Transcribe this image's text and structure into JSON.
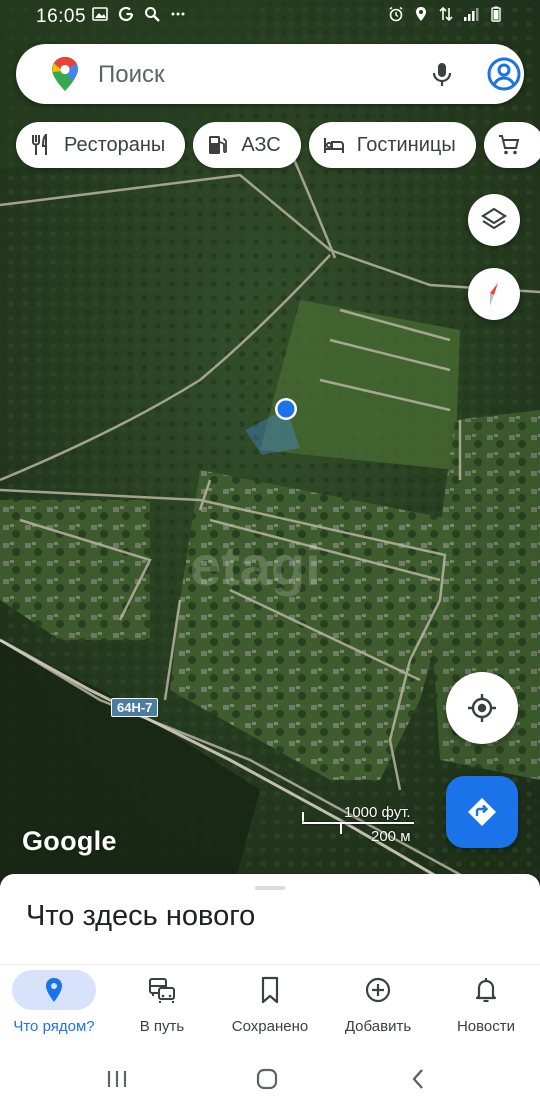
{
  "status_bar": {
    "time": "16:05",
    "left_icons": [
      "image-icon",
      "google-g-icon",
      "search-icon",
      "more-dots-icon"
    ],
    "right_icons": [
      "alarm-icon",
      "location-icon",
      "data-arrows-icon",
      "signal-icon",
      "battery-icon"
    ]
  },
  "search": {
    "placeholder": "Поиск",
    "icons": [
      "maps-pin-icon",
      "mic-icon",
      "account-icon"
    ]
  },
  "chips": [
    {
      "label": "Рестораны",
      "icon": "restaurant-icon"
    },
    {
      "label": "АЗС",
      "icon": "gas-station-icon"
    },
    {
      "label": "Гостиницы",
      "icon": "hotel-icon"
    },
    {
      "label": "",
      "icon": "shopping-cart-icon"
    }
  ],
  "map": {
    "watermark": "etagi",
    "route_badge": "64Н-7",
    "attribution": "Google",
    "scale_imperial": "1000 фут.",
    "scale_metric": "200 м",
    "buttons": [
      "layers-icon",
      "compass-icon",
      "my-location-icon",
      "directions-icon"
    ]
  },
  "sheet": {
    "title": "Что здесь нового"
  },
  "bottom_nav": {
    "active": 0,
    "items": [
      {
        "label": "Что рядом?",
        "icon": "explore-pin-icon"
      },
      {
        "label": "В путь",
        "icon": "commute-icon"
      },
      {
        "label": "Сохранено",
        "icon": "bookmark-icon"
      },
      {
        "label": "Добавить",
        "icon": "add-circle-icon"
      },
      {
        "label": "Новости",
        "icon": "bell-icon"
      }
    ]
  },
  "system_nav": [
    "recents-icon",
    "home-icon",
    "back-icon"
  ],
  "colors": {
    "accent": "#1a73e8",
    "chip_bg": "#ffffff",
    "forest_dark": "#1e2e1a",
    "field": "#4a6a36"
  }
}
